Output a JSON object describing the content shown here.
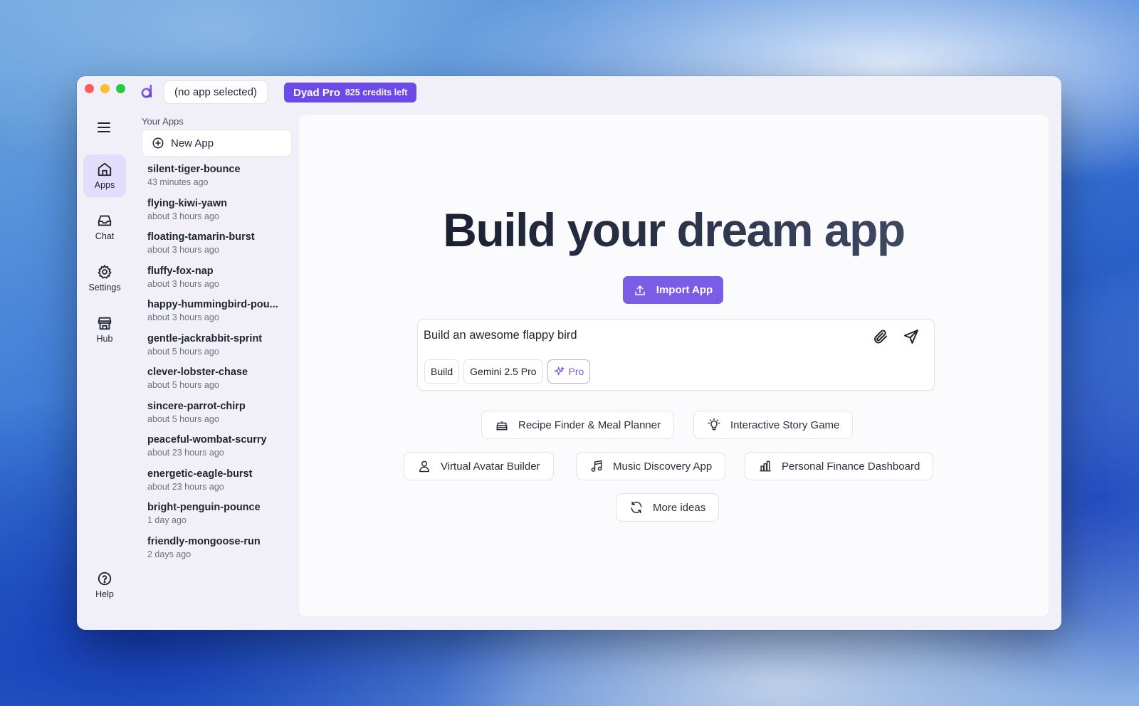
{
  "window": {
    "app_selector": "(no app selected)",
    "pro_badge": {
      "name": "Dyad Pro",
      "credits": "825 credits left"
    }
  },
  "nav": {
    "items": [
      {
        "label": "Apps",
        "icon": "home-icon"
      },
      {
        "label": "Chat",
        "icon": "inbox-icon"
      },
      {
        "label": "Settings",
        "icon": "gear-icon"
      },
      {
        "label": "Hub",
        "icon": "store-icon"
      }
    ],
    "help": {
      "label": "Help",
      "icon": "help-circle-icon"
    }
  },
  "applist": {
    "heading": "Your Apps",
    "new_app_label": "New App",
    "apps": [
      {
        "name": "silent-tiger-bounce",
        "time": "43 minutes ago"
      },
      {
        "name": "flying-kiwi-yawn",
        "time": "about 3 hours ago"
      },
      {
        "name": "floating-tamarin-burst",
        "time": "about 3 hours ago"
      },
      {
        "name": "fluffy-fox-nap",
        "time": "about 3 hours ago"
      },
      {
        "name": "happy-hummingbird-pou...",
        "time": "about 3 hours ago"
      },
      {
        "name": "gentle-jackrabbit-sprint",
        "time": "about 5 hours ago"
      },
      {
        "name": "clever-lobster-chase",
        "time": "about 5 hours ago"
      },
      {
        "name": "sincere-parrot-chirp",
        "time": "about 5 hours ago"
      },
      {
        "name": "peaceful-wombat-scurry",
        "time": "about 23 hours ago"
      },
      {
        "name": "energetic-eagle-burst",
        "time": "about 23 hours ago"
      },
      {
        "name": "bright-penguin-pounce",
        "time": "1 day ago"
      },
      {
        "name": "friendly-mongoose-run",
        "time": "2 days ago"
      }
    ]
  },
  "main": {
    "title": "Build your dream app",
    "import_label": "Import App",
    "prompt_value": "Build an awesome flappy bird",
    "chips": {
      "mode": "Build",
      "model": "Gemini 2.5 Pro",
      "pro": "Pro"
    },
    "ideas": [
      {
        "label": "Recipe Finder & Meal Planner",
        "icon": "cake-icon"
      },
      {
        "label": "Interactive Story Game",
        "icon": "lightbulb-icon"
      },
      {
        "label": "Virtual Avatar Builder",
        "icon": "user-icon"
      },
      {
        "label": "Music Discovery App",
        "icon": "music-icon"
      },
      {
        "label": "Personal Finance Dashboard",
        "icon": "bar-chart-icon"
      }
    ],
    "more_ideas_label": "More ideas"
  },
  "colors": {
    "accent": "#7a5ce6",
    "pro_badge": "#6d4ae8",
    "active_nav": "#e3dcfa"
  }
}
